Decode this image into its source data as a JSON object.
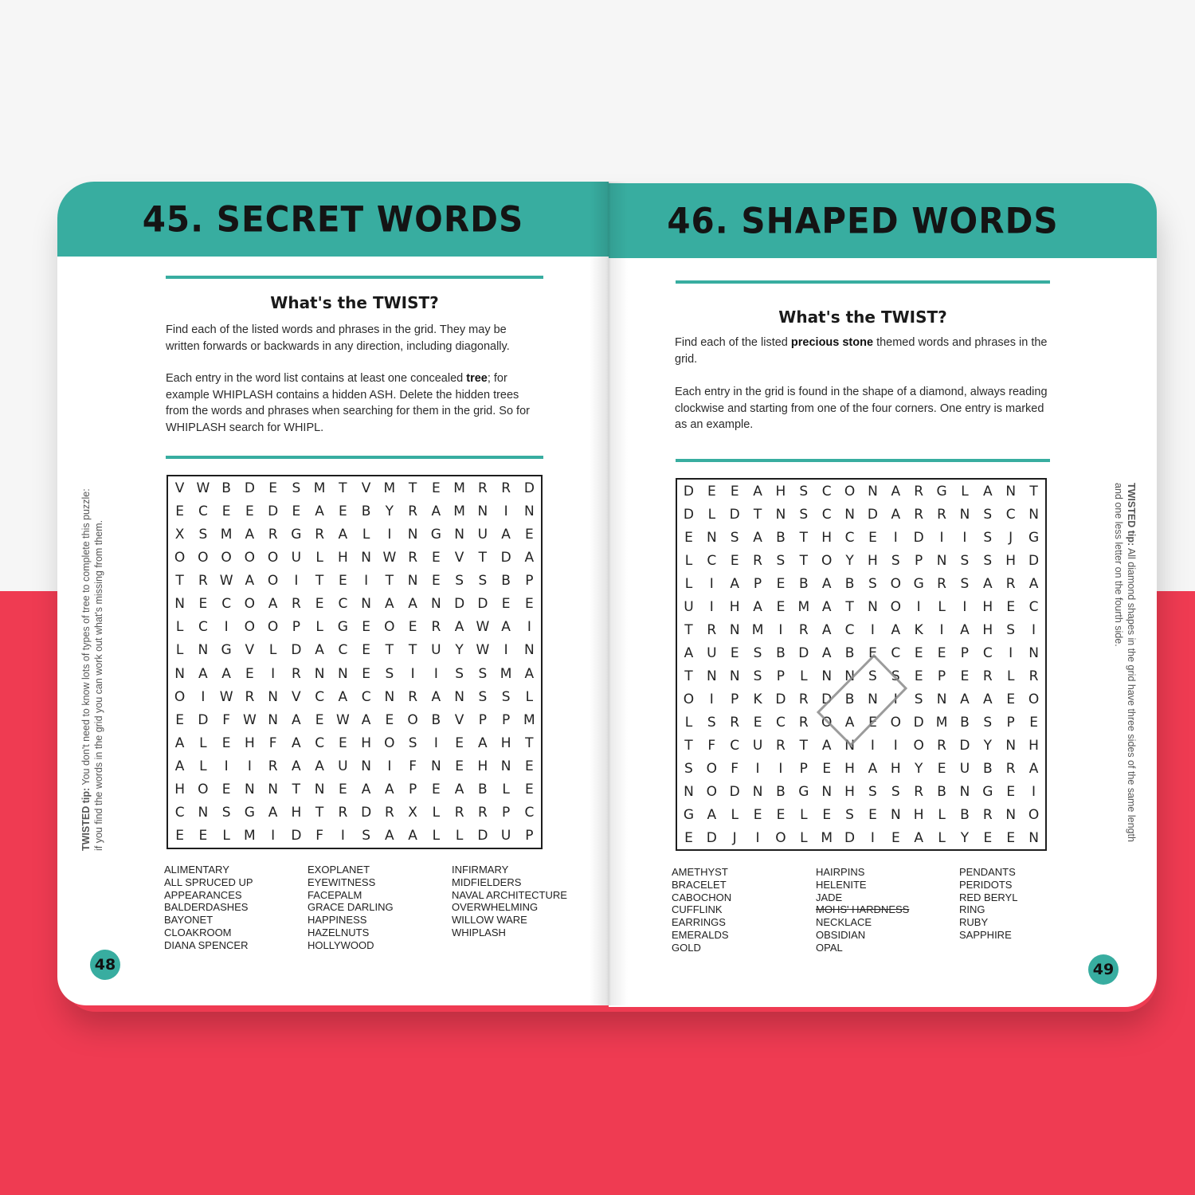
{
  "left_page": {
    "title": "45. SECRET WORDS",
    "twist_heading": "What's the TWIST?",
    "intro_1": "Find each of the listed words and phrases in the grid. They may be written forwards or backwards in any direction, including diagonally.",
    "intro_2_before": "Each entry in the word list contains at least one concealed ",
    "intro_2_bold": "tree",
    "intro_2_after": "; for example WHIPLASH contains a hidden ASH. Delete the hidden trees from the words and phrases when searching for them in the grid. So for WHIPLASH search for WHIPL.",
    "tip_label": "TWISTED tip:",
    "tip_text": " You don't need to know lots of types of tree to complete this puzzle: if you find the words in the grid you can work out what's missing from them.",
    "grid": [
      "VWBDESMTVMTEMRRD",
      "ECEEDEAEBYRAMNIN",
      "XSMARGRALINGNUAE",
      "OOOOOULHNWREVTDA",
      "TRWAOITEITNESSBP",
      "NECOARECNAANDDEE",
      "LCIOOPLGEOERAWAI",
      "LNGVLDACETTUYWIN",
      "NAAEIRNNESIISSMA",
      "OIWRNVCACNRANSSL",
      "EDFWNAEWAEOBVPPM",
      "ALEHFACEHOSIEAHT",
      "ALIIRAAUNIFNEHNE",
      "HOENNTNEAAPEABLE",
      "CNSGAHTRDRXLRRPC",
      "EELMIDFISAALLDUP"
    ],
    "words": [
      [
        "ALIMENTARY",
        "ALL SPRUCED UP",
        "APPEARANCES",
        "BALDERDASHES",
        "BAYONET",
        "CLOAKROOM",
        "DIANA SPENCER"
      ],
      [
        "EXOPLANET",
        "EYEWITNESS",
        "FACEPALM",
        "GRACE DARLING",
        "HAPPINESS",
        "HAZELNUTS",
        "HOLLYWOOD"
      ],
      [
        "INFIRMARY",
        "MIDFIELDERS",
        "NAVAL ARCHITECTURE",
        "OVERWHELMING",
        "WILLOW WARE",
        "WHIPLASH"
      ]
    ],
    "page_number": "48"
  },
  "right_page": {
    "title": "46. SHAPED WORDS",
    "twist_heading": "What's the TWIST?",
    "intro_1_before": "Find each of the listed ",
    "intro_1_bold": "precious stone",
    "intro_1_after": " themed words and phrases in the grid.",
    "intro_2": "Each entry in the grid is found in the shape of a diamond, always reading clockwise and starting from one of the four corners. One entry is marked as an example.",
    "tip_label": "TWISTED tip:",
    "tip_text": " All diamond shapes in the grid have three sides of the same length and one less letter on the fourth side.",
    "grid": [
      "DEEAHSCONARGLANT",
      "DLDTNSCNDARRNSCN",
      "ENSABTHCEIDIISJG",
      "LCERSTOYHSPNSSHD",
      "LIAPEBABSOGRSARA",
      "UIHAEMATNOILIHEC",
      "TRNMIRACIAKIAHSI",
      "AUESBDABECEEPCIN",
      "TNNSPLNNSSEPERLR",
      "OIPKDRDBNISNAAEO",
      "LSRECROAEODMBSPE",
      "TFCURTANIIORDYNH",
      "SOFIIPEHAHYEUBRA",
      "NODNBGNHSSRBNGEI",
      "GALEELESENHLBRNO",
      "EDJIOLMDIEALYEEN"
    ],
    "words": [
      [
        "AMETHYST",
        "BRACELET",
        "CABOCHON",
        "CUFFLINK",
        "EARRINGS",
        "EMERALDS",
        "GOLD"
      ],
      [
        "HAIRPINS",
        "HELENITE",
        "JADE",
        "MOHS' HARDNESS",
        "NECKLACE",
        "OBSIDIAN",
        "OPAL"
      ],
      [
        "PENDANTS",
        "PERIDOTS",
        "RED BERYL",
        "RING",
        "RUBY",
        "SAPPHIRE"
      ]
    ],
    "struck_word": "MOHS' HARDNESS",
    "page_number": "49"
  },
  "colors": {
    "teal": "#38ada0",
    "red_background": "#ef3b52",
    "page": "#ffffff",
    "text": "#222222"
  }
}
